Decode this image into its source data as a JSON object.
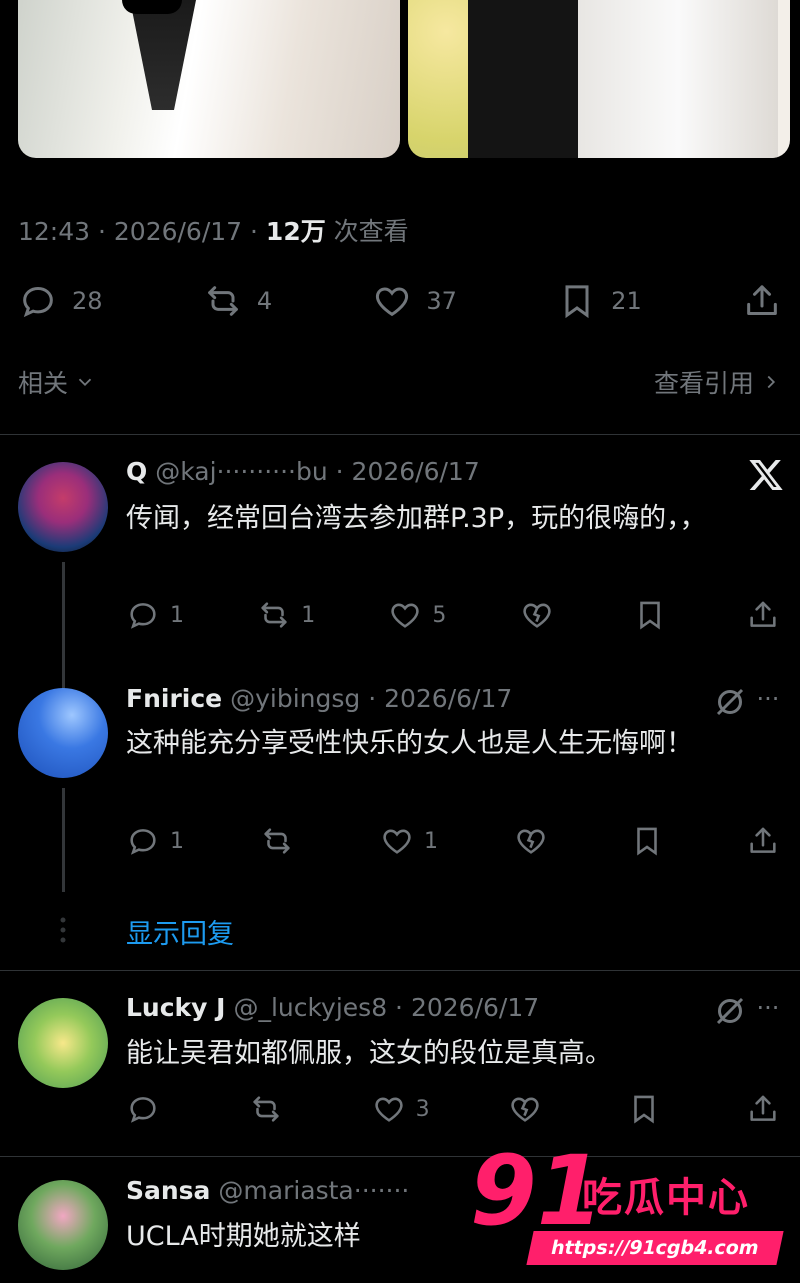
{
  "tweet": {
    "time": "12:43 · 2026/6/17 · ",
    "views_count": "12万",
    "views_label": " 次查看",
    "stats": {
      "replies": "28",
      "reposts": "4",
      "likes": "37",
      "bookmarks": "21"
    }
  },
  "related": {
    "left_label": "相关",
    "right_label": "查看引用"
  },
  "replies": [
    {
      "name": "Q",
      "handle": "@kaj··········bu · 2026/6/17",
      "text": "传闻，经常回台湾去参加群P.3P，玩的很嗨的，，",
      "reply_count": "1",
      "repost_count": "1",
      "like_count": "5"
    },
    {
      "name": "Fnirice",
      "handle": "@yibingsg · 2026/6/17",
      "text": "这种能充分享受性快乐的女人也是人生无悔啊！",
      "reply_count": "1",
      "repost_count": "",
      "like_count": "1"
    },
    {
      "name": "Lucky J",
      "handle": "@_luckyjes8 · 2026/6/17",
      "text": "能让吴君如都佩服，这女的段位是真高。",
      "reply_count": "",
      "repost_count": "",
      "like_count": "3"
    },
    {
      "name": "Sansa",
      "handle": "@mariasta·······",
      "text": "UCLA时期她就这样"
    }
  ],
  "show_replies": "显示回复",
  "watermark": {
    "number": "91",
    "brand": "吃瓜中心",
    "url": "https://91cgb4.com"
  },
  "colors": {
    "background": "#000000",
    "text": "#e7e9ea",
    "muted": "#71767b",
    "link": "#1d9bf0",
    "watermark": "#ff1f6b"
  }
}
